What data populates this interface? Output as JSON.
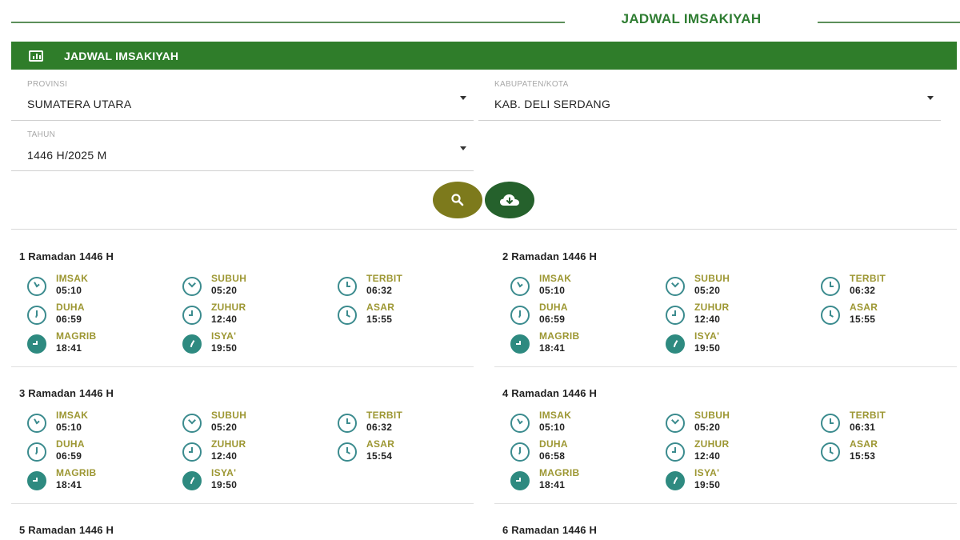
{
  "page_title": "JADWAL IMSAKIYAH",
  "header": {
    "title": "JADWAL IMSAKIYAH",
    "icon": "chart-icon"
  },
  "form": {
    "provinsi": {
      "label": "PROVINSI",
      "value": "SUMATERA UTARA"
    },
    "kabupaten": {
      "label": "KABUPATEN/KOTA",
      "value": "KAB. DELI SERDANG"
    },
    "tahun": {
      "label": "TAHUN",
      "value": "1446 H/2025 M"
    }
  },
  "buttons": {
    "search": "search-icon",
    "download": "cloud-download-icon"
  },
  "colors": {
    "primary": "#2f7d2a",
    "gold": "#9d9733",
    "teal": "#2e8a80",
    "search_btn": "#7d7a1c",
    "download_btn": "#25612c"
  },
  "days": [
    {
      "title": "1 Ramadan 1446 H",
      "prayers": [
        {
          "name": "IMSAK",
          "time": "05:10"
        },
        {
          "name": "SUBUH",
          "time": "05:20"
        },
        {
          "name": "TERBIT",
          "time": "06:32"
        },
        {
          "name": "DUHA",
          "time": "06:59"
        },
        {
          "name": "ZUHUR",
          "time": "12:40"
        },
        {
          "name": "ASAR",
          "time": "15:55"
        },
        {
          "name": "MAGRIB",
          "time": "18:41"
        },
        {
          "name": "ISYA'",
          "time": "19:50"
        }
      ]
    },
    {
      "title": "2 Ramadan 1446 H",
      "prayers": [
        {
          "name": "IMSAK",
          "time": "05:10"
        },
        {
          "name": "SUBUH",
          "time": "05:20"
        },
        {
          "name": "TERBIT",
          "time": "06:32"
        },
        {
          "name": "DUHA",
          "time": "06:59"
        },
        {
          "name": "ZUHUR",
          "time": "12:40"
        },
        {
          "name": "ASAR",
          "time": "15:55"
        },
        {
          "name": "MAGRIB",
          "time": "18:41"
        },
        {
          "name": "ISYA'",
          "time": "19:50"
        }
      ]
    },
    {
      "title": "3 Ramadan 1446 H",
      "prayers": [
        {
          "name": "IMSAK",
          "time": "05:10"
        },
        {
          "name": "SUBUH",
          "time": "05:20"
        },
        {
          "name": "TERBIT",
          "time": "06:32"
        },
        {
          "name": "DUHA",
          "time": "06:59"
        },
        {
          "name": "ZUHUR",
          "time": "12:40"
        },
        {
          "name": "ASAR",
          "time": "15:54"
        },
        {
          "name": "MAGRIB",
          "time": "18:41"
        },
        {
          "name": "ISYA'",
          "time": "19:50"
        }
      ]
    },
    {
      "title": "4 Ramadan 1446 H",
      "prayers": [
        {
          "name": "IMSAK",
          "time": "05:10"
        },
        {
          "name": "SUBUH",
          "time": "05:20"
        },
        {
          "name": "TERBIT",
          "time": "06:31"
        },
        {
          "name": "DUHA",
          "time": "06:58"
        },
        {
          "name": "ZUHUR",
          "time": "12:40"
        },
        {
          "name": "ASAR",
          "time": "15:53"
        },
        {
          "name": "MAGRIB",
          "time": "18:41"
        },
        {
          "name": "ISYA'",
          "time": "19:50"
        }
      ]
    },
    {
      "title": "5 Ramadan 1446 H",
      "prayers": []
    },
    {
      "title": "6 Ramadan 1446 H",
      "prayers": []
    }
  ]
}
